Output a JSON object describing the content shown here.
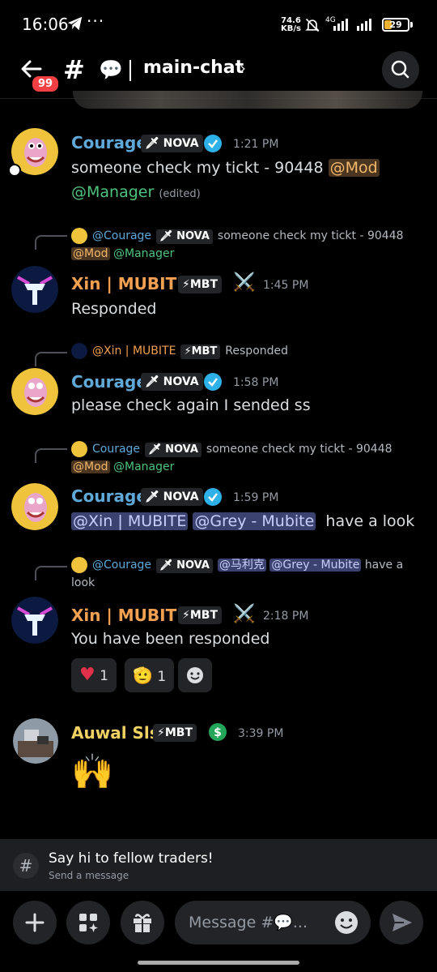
{
  "status": {
    "time": "16:06",
    "net_speed_top": "74.6",
    "net_speed_unit": "KB/s",
    "network": "4G",
    "battery": "29",
    "battery_level": 0.29
  },
  "header": {
    "unread_badge": "99",
    "channel_emoji": "💬",
    "channel_name": "main-chat"
  },
  "colors": {
    "courage": "#5fa9d9",
    "xin": "#f0a050",
    "auwal": "#f0d264",
    "mention_orange": "#f4b86b",
    "mention_green": "#4ec27f"
  },
  "messages": [
    {
      "author": "Courage",
      "tag": "NOVA",
      "time": "1:21 PM",
      "text_a": "someone check my tickt - 90448 ",
      "mention_mod": "@Mod",
      "mention_manager": "@Manager",
      "edited": "(edited)"
    },
    {
      "reply_author": "@Courage",
      "reply_tag": "NOVA",
      "reply_text": "someone check my tickt - 90448",
      "reply_mod": "@Mod",
      "reply_manager": "@Manager",
      "author": "Xin | MUBITE",
      "tag": "MBT",
      "time": "1:45 PM",
      "text": "Responded"
    },
    {
      "reply_author": "@Xin | MUBITE",
      "reply_tag": "MBT",
      "reply_text": "Responded",
      "author": "Courage",
      "tag": "NOVA",
      "time": "1:58 PM",
      "text": "please check again I sended ss"
    },
    {
      "reply_author": "Courage",
      "reply_tag": "NOVA",
      "reply_text": "someone check my tickt - 90448",
      "reply_mod": "@Mod",
      "reply_manager": "@Manager",
      "author": "Courage",
      "tag": "NOVA",
      "time": "1:59 PM",
      "mention_xin": "@Xin | MUBITE",
      "mention_grey": "@Grey - Mubite",
      "text": "have a look"
    },
    {
      "reply_author": "@Courage",
      "reply_tag": "NOVA",
      "reply_mention1": "@马利克",
      "reply_mention2": "@Grey - Mubite",
      "reply_text": "have a",
      "reply_text2": "look",
      "author": "Xin | MUBITE",
      "tag": "MBT",
      "time": "2:18 PM",
      "text": "You have been responded",
      "reactions": [
        {
          "emoji": "heart",
          "count": "1"
        },
        {
          "emoji": "saluting-face",
          "count": "1"
        }
      ]
    },
    {
      "author": "Auwal Sls",
      "tag": "MBT",
      "time": "3:39 PM",
      "text": "🙌"
    }
  ],
  "composer": {
    "banner_title": "Say hi to fellow traders!",
    "banner_sub": "Send a message",
    "placeholder": "Message #💬..."
  }
}
